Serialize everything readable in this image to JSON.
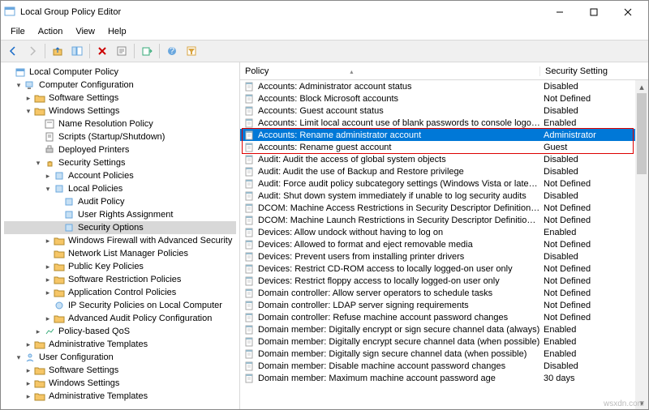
{
  "window": {
    "title": "Local Group Policy Editor"
  },
  "menu": [
    "File",
    "Action",
    "View",
    "Help"
  ],
  "tree": {
    "root": "Local Computer Policy",
    "cc": "Computer Configuration",
    "ss": "Software Settings",
    "ws": "Windows Settings",
    "nrp": "Name Resolution Policy",
    "scr": "Scripts (Startup/Shutdown)",
    "dp": "Deployed Printers",
    "sec": "Security Settings",
    "ap": "Account Policies",
    "lp": "Local Policies",
    "aup": "Audit Policy",
    "ura": "User Rights Assignment",
    "so": "Security Options",
    "wfas": "Windows Firewall with Advanced Security",
    "nlmp": "Network List Manager Policies",
    "pkp": "Public Key Policies",
    "srp": "Software Restriction Policies",
    "acp": "Application Control Policies",
    "ipsec": "IP Security Policies on Local Computer",
    "aapc": "Advanced Audit Policy Configuration",
    "pqos": "Policy-based QoS",
    "at": "Administrative Templates",
    "uc": "User Configuration",
    "ss2": "Software Settings",
    "ws2": "Windows Settings",
    "at2": "Administrative Templates"
  },
  "cols": {
    "policy": "Policy",
    "setting": "Security Setting"
  },
  "policies": [
    {
      "n": "Accounts: Administrator account status",
      "v": "Disabled"
    },
    {
      "n": "Accounts: Block Microsoft accounts",
      "v": "Not Defined"
    },
    {
      "n": "Accounts: Guest account status",
      "v": "Disabled"
    },
    {
      "n": "Accounts: Limit local account use of blank passwords to console logon only",
      "v": "Enabled"
    },
    {
      "n": "Accounts: Rename administrator account",
      "v": "Administrator",
      "sel": true
    },
    {
      "n": "Accounts: Rename guest account",
      "v": "Guest"
    },
    {
      "n": "Audit: Audit the access of global system objects",
      "v": "Disabled"
    },
    {
      "n": "Audit: Audit the use of Backup and Restore privilege",
      "v": "Disabled"
    },
    {
      "n": "Audit: Force audit policy subcategory settings (Windows Vista or later) to ov...",
      "v": "Not Defined"
    },
    {
      "n": "Audit: Shut down system immediately if unable to log security audits",
      "v": "Disabled"
    },
    {
      "n": "DCOM: Machine Access Restrictions in Security Descriptor Definition Langua...",
      "v": "Not Defined"
    },
    {
      "n": "DCOM: Machine Launch Restrictions in Security Descriptor Definition Langua...",
      "v": "Not Defined"
    },
    {
      "n": "Devices: Allow undock without having to log on",
      "v": "Enabled"
    },
    {
      "n": "Devices: Allowed to format and eject removable media",
      "v": "Not Defined"
    },
    {
      "n": "Devices: Prevent users from installing printer drivers",
      "v": "Disabled"
    },
    {
      "n": "Devices: Restrict CD-ROM access to locally logged-on user only",
      "v": "Not Defined"
    },
    {
      "n": "Devices: Restrict floppy access to locally logged-on user only",
      "v": "Not Defined"
    },
    {
      "n": "Domain controller: Allow server operators to schedule tasks",
      "v": "Not Defined"
    },
    {
      "n": "Domain controller: LDAP server signing requirements",
      "v": "Not Defined"
    },
    {
      "n": "Domain controller: Refuse machine account password changes",
      "v": "Not Defined"
    },
    {
      "n": "Domain member: Digitally encrypt or sign secure channel data (always)",
      "v": "Enabled"
    },
    {
      "n": "Domain member: Digitally encrypt secure channel data (when possible)",
      "v": "Enabled"
    },
    {
      "n": "Domain member: Digitally sign secure channel data (when possible)",
      "v": "Enabled"
    },
    {
      "n": "Domain member: Disable machine account password changes",
      "v": "Disabled"
    },
    {
      "n": "Domain member: Maximum machine account password age",
      "v": "30 days"
    }
  ],
  "watermark": "wsxdn.com"
}
